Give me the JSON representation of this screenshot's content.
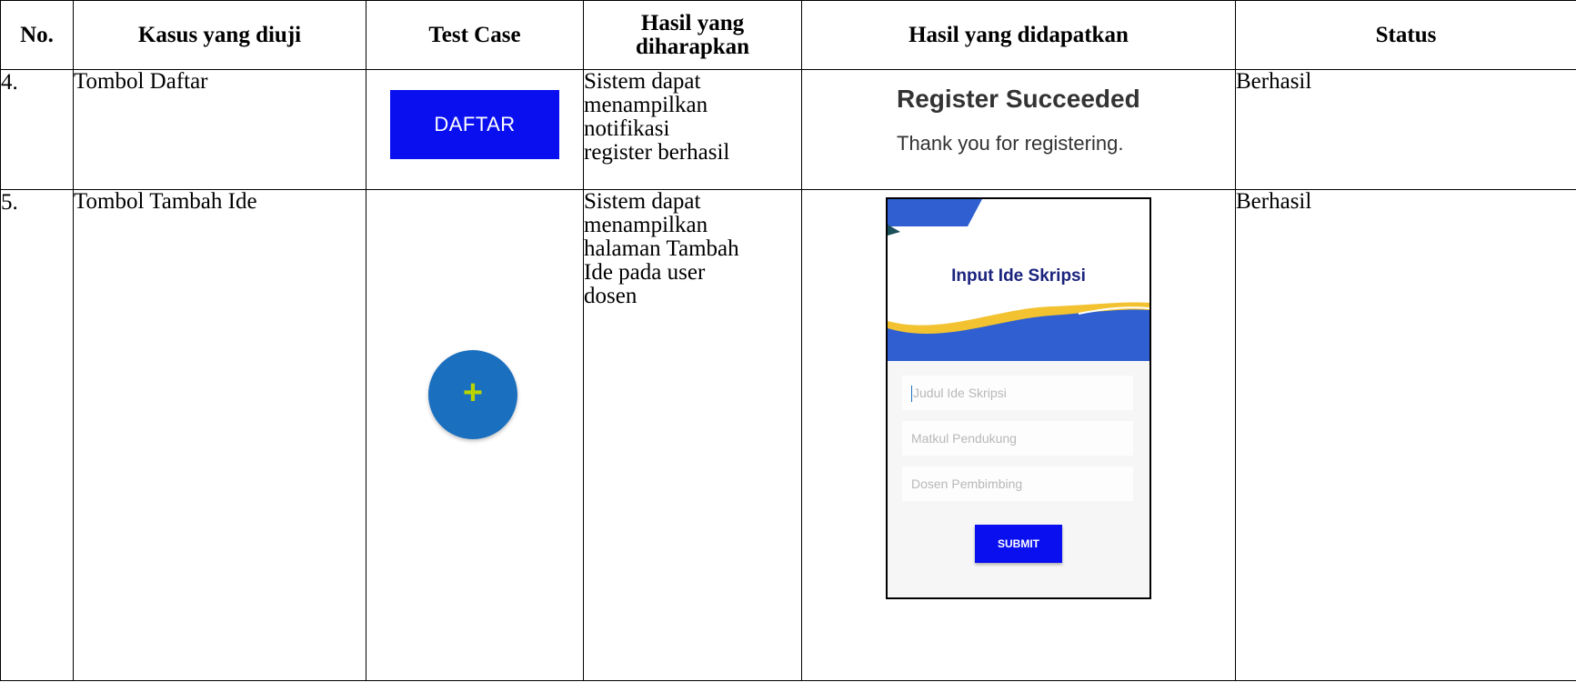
{
  "headers": {
    "no": "No.",
    "kasus": "Kasus yang diuji",
    "test_case": "Test Case",
    "hasil_diharapkan": "Hasil yang diharapkan",
    "hasil_didapatkan": "Hasil yang didapatkan",
    "status": "Status"
  },
  "rows": [
    {
      "no": "4.",
      "kasus": "Tombol Daftar",
      "test_case_button": "DAFTAR",
      "hasil_diharapkan": [
        "Sistem dapat",
        "menampilkan",
        "notifikasi",
        "register berhasil"
      ],
      "result_title": "Register Succeeded",
      "result_message": "Thank you for registering.",
      "status": "Berhasil"
    },
    {
      "no": "5.",
      "kasus": "Tombol Tambah Ide",
      "test_case_icon": "add-icon",
      "test_case_plus": "+",
      "hasil_diharapkan": [
        "Sistem dapat",
        "menampilkan",
        "halaman Tambah",
        "Ide pada user",
        "dosen"
      ],
      "screen_title": "Input Ide Skripsi",
      "fields": {
        "judul_placeholder": "Judul Ide Skripsi",
        "matkul_placeholder": "Matkul Pendukung",
        "dosen_placeholder": "Dosen Pembimbing"
      },
      "submit_label": "SUBMIT",
      "status": "Berhasil"
    }
  ],
  "colors": {
    "button_blue": "#0a0ff0",
    "fab_blue": "#1a6fbf",
    "plus_green": "#b8d400",
    "wave_blue": "#2f5fd0",
    "wave_yellow": "#f2c230",
    "title_navy": "#1a237e"
  }
}
